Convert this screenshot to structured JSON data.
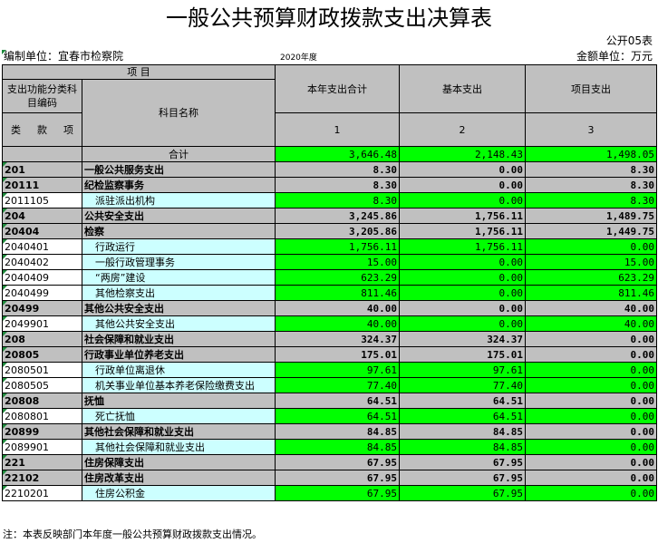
{
  "title": "一般公共预算财政拨款支出决算表",
  "form_no": "公开05表",
  "unit_label": "编制单位：宜春市检察院",
  "year": "2020年度",
  "currency_label": "金额单位：万元",
  "header": {
    "xiangmu": "项 目",
    "code_label": "支出功能分类科目编码",
    "name_label": "科目名称",
    "col_total": "本年支出合计",
    "col_basic": "基本支出",
    "col_project": "项目支出",
    "lei": "类",
    "kuan": "款",
    "xiang": "项",
    "lanci": "栏次",
    "heji": "合计",
    "n1": "1",
    "n2": "2",
    "n3": "3"
  },
  "totals": {
    "total": "3,646.48",
    "basic": "2,148.43",
    "project": "1,498.05"
  },
  "rows": [
    {
      "code": "201",
      "name": "一般公共服务支出",
      "total": "8.30",
      "basic": "0.00",
      "project": "8.30",
      "level": 1
    },
    {
      "code": "20111",
      "name": "纪检监察事务",
      "total": "8.30",
      "basic": "0.00",
      "project": "8.30",
      "level": 2
    },
    {
      "code": "2011105",
      "name": "派驻派出机构",
      "total": "8.30",
      "basic": "0.00",
      "project": "8.30",
      "level": 3
    },
    {
      "code": "204",
      "name": "公共安全支出",
      "total": "3,245.86",
      "basic": "1,756.11",
      "project": "1,489.75",
      "level": 1
    },
    {
      "code": "20404",
      "name": "检察",
      "total": "3,205.86",
      "basic": "1,756.11",
      "project": "1,449.75",
      "level": 2
    },
    {
      "code": "2040401",
      "name": "行政运行",
      "total": "1,756.11",
      "basic": "1,756.11",
      "project": "0.00",
      "level": 3
    },
    {
      "code": "2040402",
      "name": "一般行政管理事务",
      "total": "15.00",
      "basic": "0.00",
      "project": "15.00",
      "level": 3
    },
    {
      "code": "2040409",
      "name": "“两房”建设",
      "total": "623.29",
      "basic": "0.00",
      "project": "623.29",
      "level": 3
    },
    {
      "code": "2040499",
      "name": "其他检察支出",
      "total": "811.46",
      "basic": "0.00",
      "project": "811.46",
      "level": 3
    },
    {
      "code": "20499",
      "name": "其他公共安全支出",
      "total": "40.00",
      "basic": "0.00",
      "project": "40.00",
      "level": 2
    },
    {
      "code": "2049901",
      "name": "其他公共安全支出",
      "total": "40.00",
      "basic": "0.00",
      "project": "40.00",
      "level": 3
    },
    {
      "code": "208",
      "name": "社会保障和就业支出",
      "total": "324.37",
      "basic": "324.37",
      "project": "0.00",
      "level": 1
    },
    {
      "code": "20805",
      "name": "行政事业单位养老支出",
      "total": "175.01",
      "basic": "175.01",
      "project": "0.00",
      "level": 2
    },
    {
      "code": "2080501",
      "name": "行政单位离退休",
      "total": "97.61",
      "basic": "97.61",
      "project": "0.00",
      "level": 3
    },
    {
      "code": "2080505",
      "name": "机关事业单位基本养老保险缴费支出",
      "total": "77.40",
      "basic": "77.40",
      "project": "0.00",
      "level": 3
    },
    {
      "code": "20808",
      "name": "抚恤",
      "total": "64.51",
      "basic": "64.51",
      "project": "0.00",
      "level": 2
    },
    {
      "code": "2080801",
      "name": "死亡抚恤",
      "total": "64.51",
      "basic": "64.51",
      "project": "0.00",
      "level": 3
    },
    {
      "code": "20899",
      "name": "其他社会保障和就业支出",
      "total": "84.85",
      "basic": "84.85",
      "project": "0.00",
      "level": 2
    },
    {
      "code": "2089901",
      "name": "其他社会保障和就业支出",
      "total": "84.85",
      "basic": "84.85",
      "project": "0.00",
      "level": 3
    },
    {
      "code": "221",
      "name": "住房保障支出",
      "total": "67.95",
      "basic": "67.95",
      "project": "0.00",
      "level": 1
    },
    {
      "code": "22102",
      "name": "住房改革支出",
      "total": "67.95",
      "basic": "67.95",
      "project": "0.00",
      "level": 2
    },
    {
      "code": "2210201",
      "name": "住房公积金",
      "total": "67.95",
      "basic": "67.95",
      "project": "0.00",
      "level": 3
    }
  ],
  "note": "注：本表反映部门本年度一般公共预算财政拨款支出情况。",
  "colors": {
    "header_grey": "#c0c0c0",
    "value_green": "#00ff00",
    "name_cyan": "#ccffff",
    "marker_green": "#1e8a3c"
  }
}
